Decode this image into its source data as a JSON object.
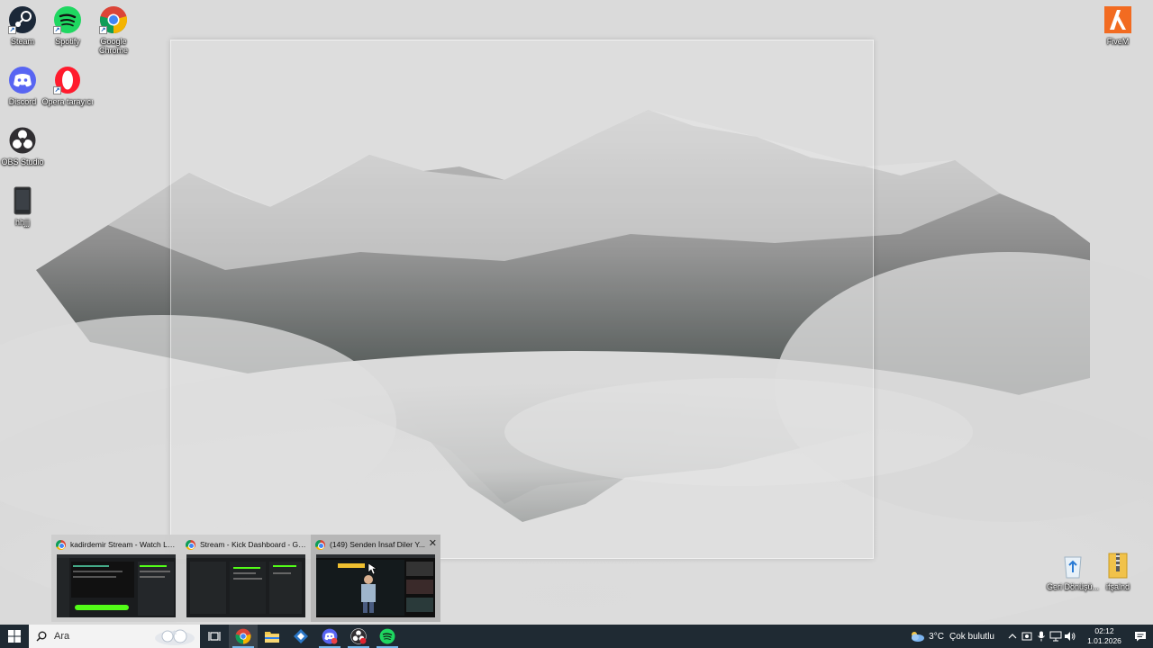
{
  "desktop": {
    "icons": [
      {
        "label": "Steam"
      },
      {
        "label": "Spotify"
      },
      {
        "label": "Google Chrome"
      },
      {
        "label": "Discord"
      },
      {
        "label": "Opera tarayıcı"
      },
      {
        "label": "OBS Studio"
      },
      {
        "label": "hhjjj"
      },
      {
        "label": "FiveM"
      },
      {
        "label": "Geri Dönüşü..."
      },
      {
        "label": "ifşalnd"
      }
    ]
  },
  "flyout": {
    "windows": [
      {
        "title": "kadirdemir Stream - Watch Live..."
      },
      {
        "title": "Stream - Kick Dashboard - Goo..."
      },
      {
        "title": "(149) Senden İnsaf Diler Y...",
        "close_label": "✕"
      }
    ]
  },
  "taskbar": {
    "search_placeholder": "Ara",
    "pinned": [
      "task-view",
      "chrome",
      "file-explorer",
      "app-blue",
      "discord",
      "obs",
      "spotify"
    ],
    "weather": {
      "temp": "3°C",
      "condition": "Çok bulutlu"
    },
    "clock": {
      "time": "02:12",
      "date": "1.01.2026"
    }
  },
  "colors": {
    "taskbar_bg": "#1f2a33",
    "accent": "#76b9ed"
  }
}
